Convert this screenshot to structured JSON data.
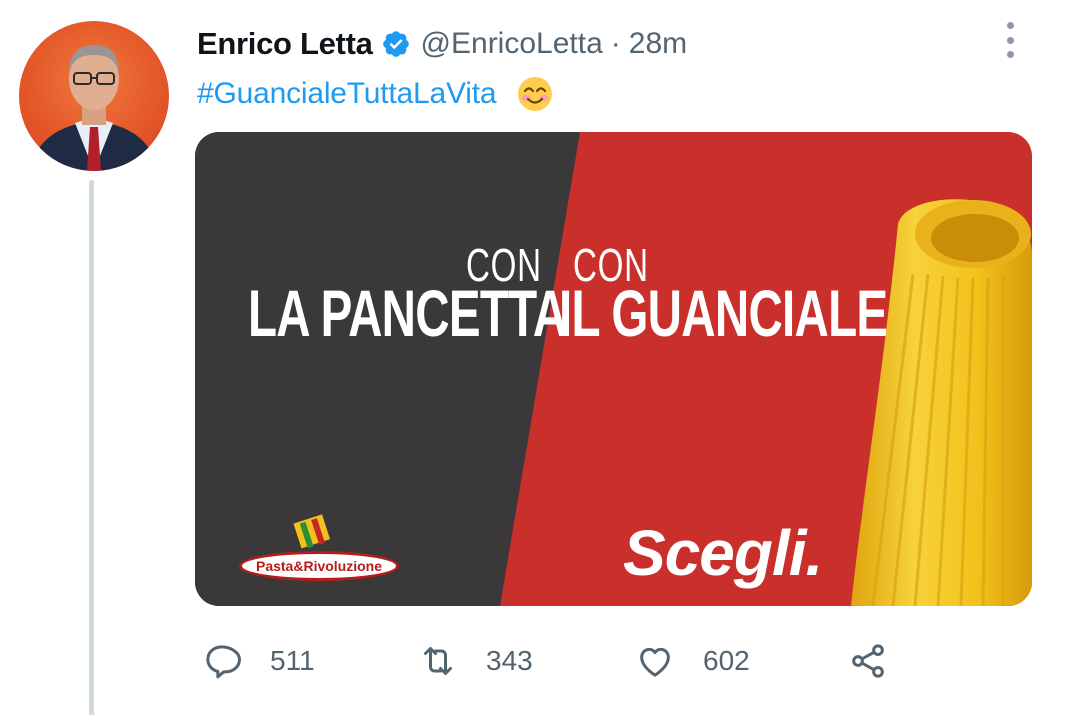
{
  "tweet": {
    "author_name": "Enrico Letta",
    "handle": "@EnricoLetta",
    "separator": "·",
    "time": "28m",
    "text_hashtag": "#GuancialeTuttaLaVita",
    "emoji_icon": "smiling-face-with-smiling-eyes-icon",
    "verified_icon": "verified-badge-icon"
  },
  "media": {
    "left_small": "CON",
    "left_big": "LA PANCETTA",
    "right_small": "CON",
    "right_big": "IL GUANCIALE",
    "cta": "Scegli.",
    "logo_text": "Pasta&Rivoluzione",
    "colors": {
      "dark_panel": "#3a3839",
      "red_panel": "#c9302c",
      "pasta": "#f2c21c"
    }
  },
  "actions": {
    "reply_count": "511",
    "retweet_count": "343",
    "like_count": "602"
  },
  "colors": {
    "link": "#1d9bf0",
    "secondary_text": "#536471",
    "thread_line": "#cfd9de"
  }
}
